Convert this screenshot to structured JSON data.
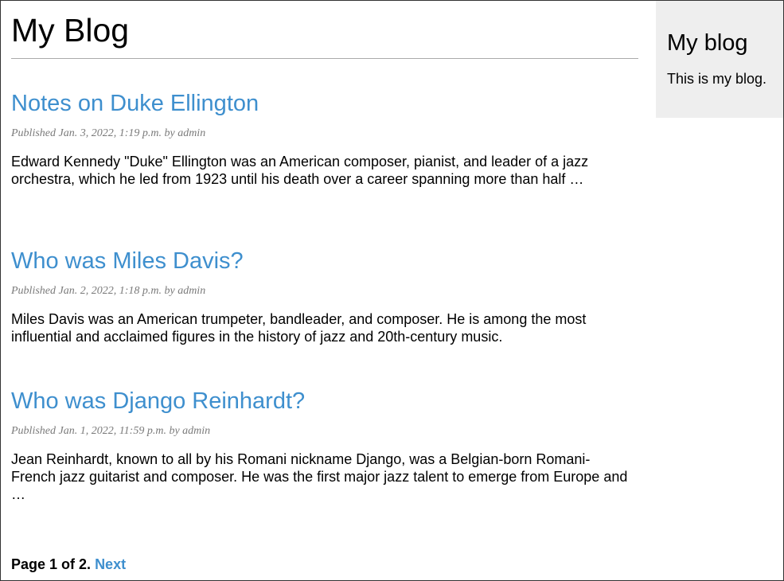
{
  "header": {
    "site_title": "My Blog"
  },
  "posts": [
    {
      "title": "Notes on Duke Ellington",
      "meta": "Published Jan. 3, 2022, 1:19 p.m. by admin",
      "excerpt": "Edward Kennedy \"Duke\" Ellington was an American composer, pianist, and leader of a jazz orchestra, which he led from 1923 until his death over a career spanning more than half …"
    },
    {
      "title": "Who was Miles Davis?",
      "meta": "Published Jan. 2, 2022, 1:18 p.m. by admin",
      "excerpt": "Miles Davis was an American trumpeter, bandleader, and composer. He is among the most influential and acclaimed figures in the history of jazz and 20th-century music."
    },
    {
      "title": "Who was Django Reinhardt?",
      "meta": "Published Jan. 1, 2022, 11:59 p.m. by admin",
      "excerpt": "Jean Reinhardt, known to all by his Romani nickname Django, was a Belgian-born Romani-French jazz guitarist and composer. He was the first major jazz talent to emerge from Europe and …"
    }
  ],
  "pagination": {
    "page_text": "Page 1 of 2.",
    "next_label": "Next"
  },
  "sidebar": {
    "title": "My blog",
    "description": "This is my blog."
  },
  "colors": {
    "link": "#3e8fce",
    "meta": "#7a7a7a",
    "sidebar_bg": "#eeeeee"
  }
}
